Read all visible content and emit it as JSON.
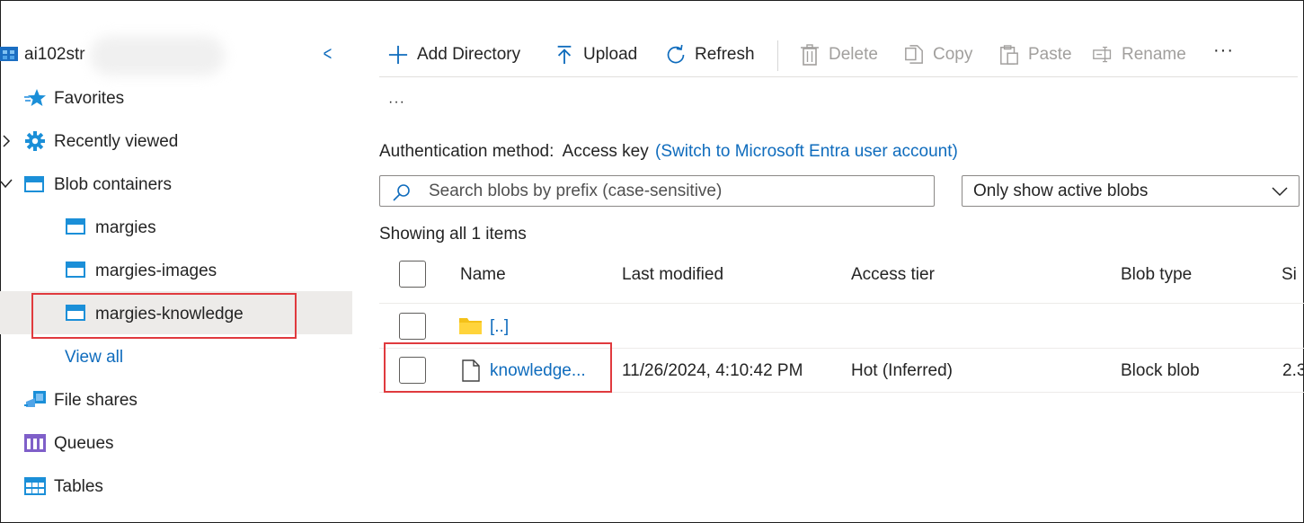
{
  "sidebar": {
    "account_name": "ai102str",
    "collapse_glyph": "<",
    "items": [
      {
        "label": "Favorites",
        "icon": "favorites-star-icon"
      },
      {
        "label": "Recently viewed",
        "icon": "recently-viewed-gear-icon"
      },
      {
        "label": "Blob containers",
        "icon": "blob-containers-icon"
      },
      {
        "label": "margies",
        "icon": "container-icon"
      },
      {
        "label": "margies-images",
        "icon": "container-icon"
      },
      {
        "label": "margies-knowledge",
        "icon": "container-icon",
        "selected": true
      },
      {
        "label": "View all"
      },
      {
        "label": "File shares",
        "icon": "file-shares-icon"
      },
      {
        "label": "Queues",
        "icon": "queues-icon"
      },
      {
        "label": "Tables",
        "icon": "tables-icon"
      }
    ]
  },
  "toolbar": {
    "add_directory": "Add Directory",
    "upload": "Upload",
    "refresh": "Refresh",
    "delete": "Delete",
    "copy": "Copy",
    "paste": "Paste",
    "rename": "Rename",
    "more": "···",
    "overflow": "···"
  },
  "auth": {
    "label": "Authentication method:",
    "value": "Access key",
    "switch_link": "(Switch to Microsoft Entra user account)"
  },
  "search": {
    "placeholder": "Search blobs by prefix (case-sensitive)"
  },
  "filter": {
    "selected": "Only show active blobs"
  },
  "list": {
    "summary": "Showing all 1 items",
    "columns": [
      "Name",
      "Last modified",
      "Access tier",
      "Blob type",
      "Si"
    ],
    "parent_row": {
      "name": "[..]"
    },
    "rows": [
      {
        "name": "knowledge...",
        "last_modified": "11/26/2024, 4:10:42 PM",
        "access_tier": "Hot (Inferred)",
        "blob_type": "Block blob",
        "size": "2.3"
      }
    ]
  },
  "colors": {
    "accent": "#0f6cbd",
    "highlight": "#e03a3e",
    "selected_bg": "#edebe9",
    "disabled": "#a19f9d"
  }
}
